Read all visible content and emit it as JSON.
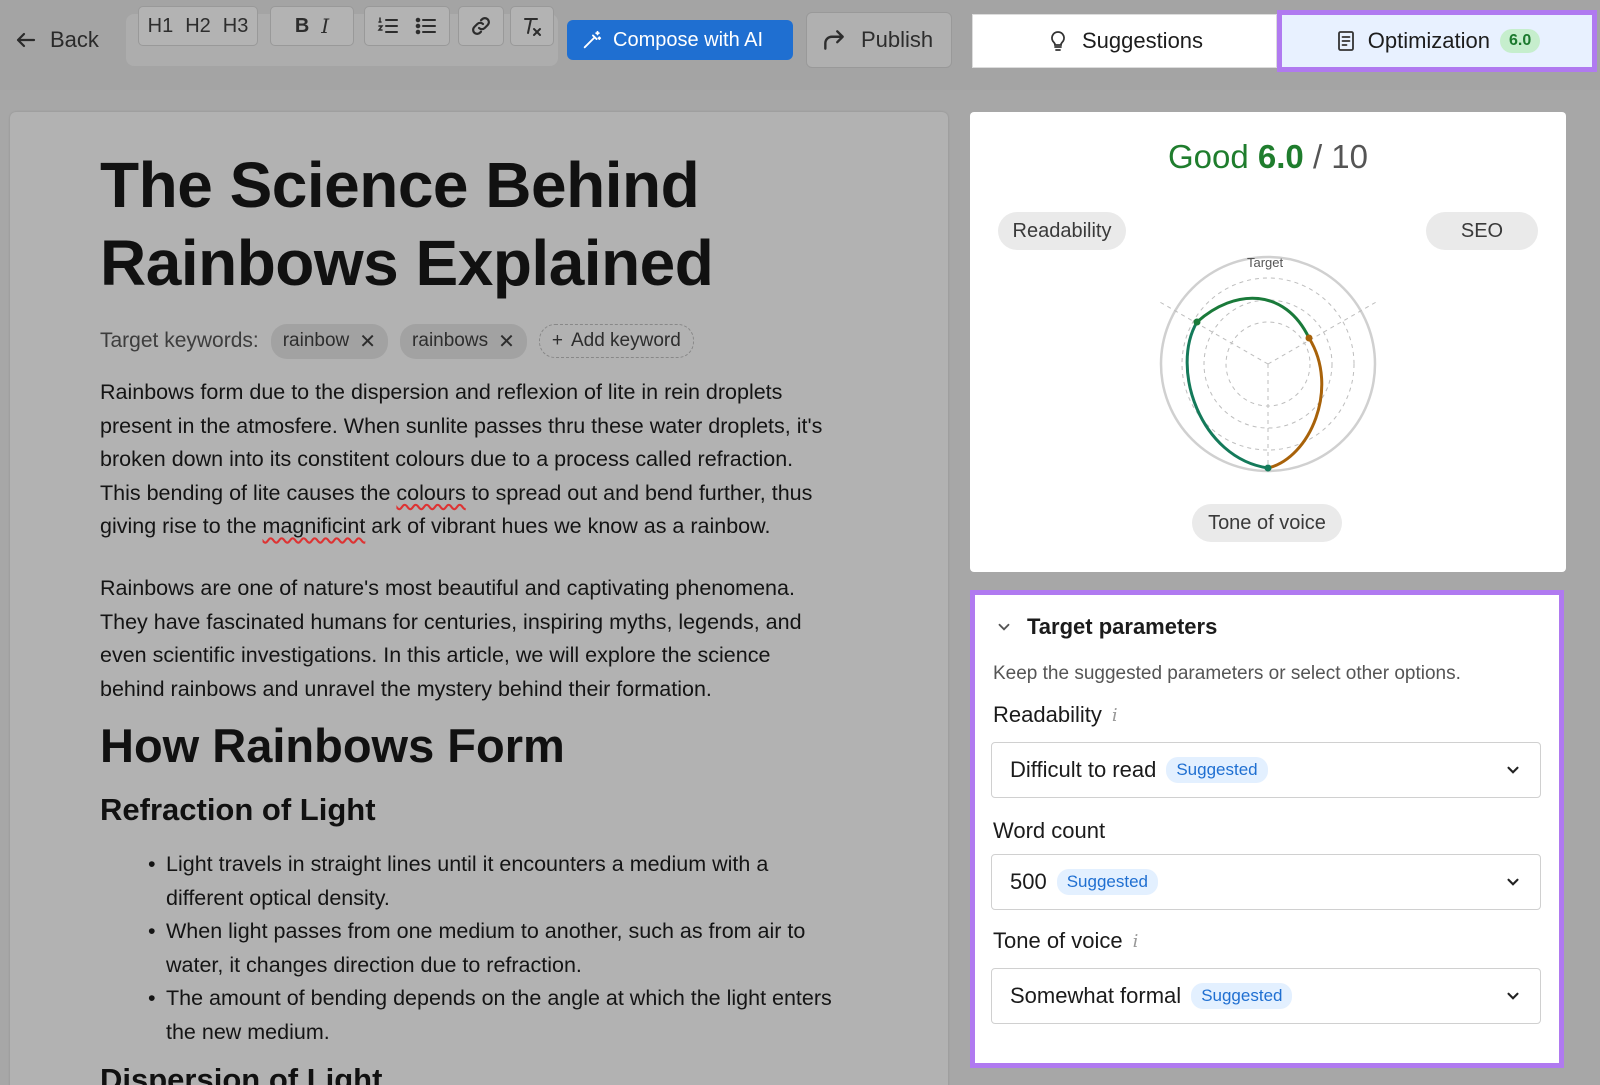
{
  "toolbar": {
    "back_label": "Back",
    "heading_buttons": [
      "H1",
      "H2",
      "H3"
    ],
    "bold_label": "B",
    "italic_label": "I",
    "compose_label": "Compose with AI",
    "publish_label": "Publish"
  },
  "tabs": {
    "suggestions_label": "Suggestions",
    "optimization_label": "Optimization",
    "optimization_score": "6.0"
  },
  "document": {
    "title_line1": "The Science Behind",
    "title_line2": "Rainbows Explained",
    "keywords_label": "Target keywords:",
    "keywords": [
      "rainbow",
      "rainbows"
    ],
    "add_keyword_label": "Add keyword",
    "p1": {
      "l1": "Rainbows form due to the dispersion and reflexion of lite in rein droplets",
      "l2": "present in the atmosfere. When sunlite passes thru these water droplets, it's",
      "l3": "broken down into its constitent colours due to a process called refraction.",
      "l4a": "This bending of lite causes the ",
      "l4b": "colours",
      "l4c": " to spread out and bend further, thus",
      "l5a": "giving rise to the ",
      "l5b": "magnificint",
      "l5c": " ark of vibrant hues we know as a rainbow."
    },
    "p2": {
      "l1": "Rainbows are one of nature's most beautiful and captivating phenomena.",
      "l2": "They have fascinated humans for centuries, inspiring myths, legends, and",
      "l3": "even scientific investigations. In this article, we will explore the science",
      "l4": "behind rainbows and unravel the mystery behind their formation."
    },
    "h2": "How Rainbows Form",
    "h3_1": "Refraction of Light",
    "bullets": [
      [
        "Light travels in straight lines until it encounters a medium with a",
        "different optical density."
      ],
      [
        "When light passes from one medium to another, such as from air to",
        "water, it changes direction due to refraction."
      ],
      [
        "The amount of bending depends on the angle at which the light enters",
        "the new medium."
      ]
    ],
    "h3_2": "Dispersion of Light"
  },
  "score": {
    "rating": "Good",
    "value": "6.0",
    "separator": "/",
    "max": "10",
    "readability_label": "Readability",
    "seo_label": "SEO",
    "tone_label": "Tone of voice",
    "target_label": "Target",
    "colors": {
      "good": "#1f7d2d",
      "seo_arc": "#a8620a"
    }
  },
  "params": {
    "heading": "Target parameters",
    "description": "Keep the suggested parameters or select other options.",
    "readability_label": "Readability",
    "readability_value": "Difficult to read",
    "word_count_label": "Word count",
    "word_count_value": "500",
    "tone_label": "Tone of voice",
    "tone_value": "Somewhat formal",
    "suggested_badge": "Suggested",
    "info_icon_glyph": "i"
  }
}
